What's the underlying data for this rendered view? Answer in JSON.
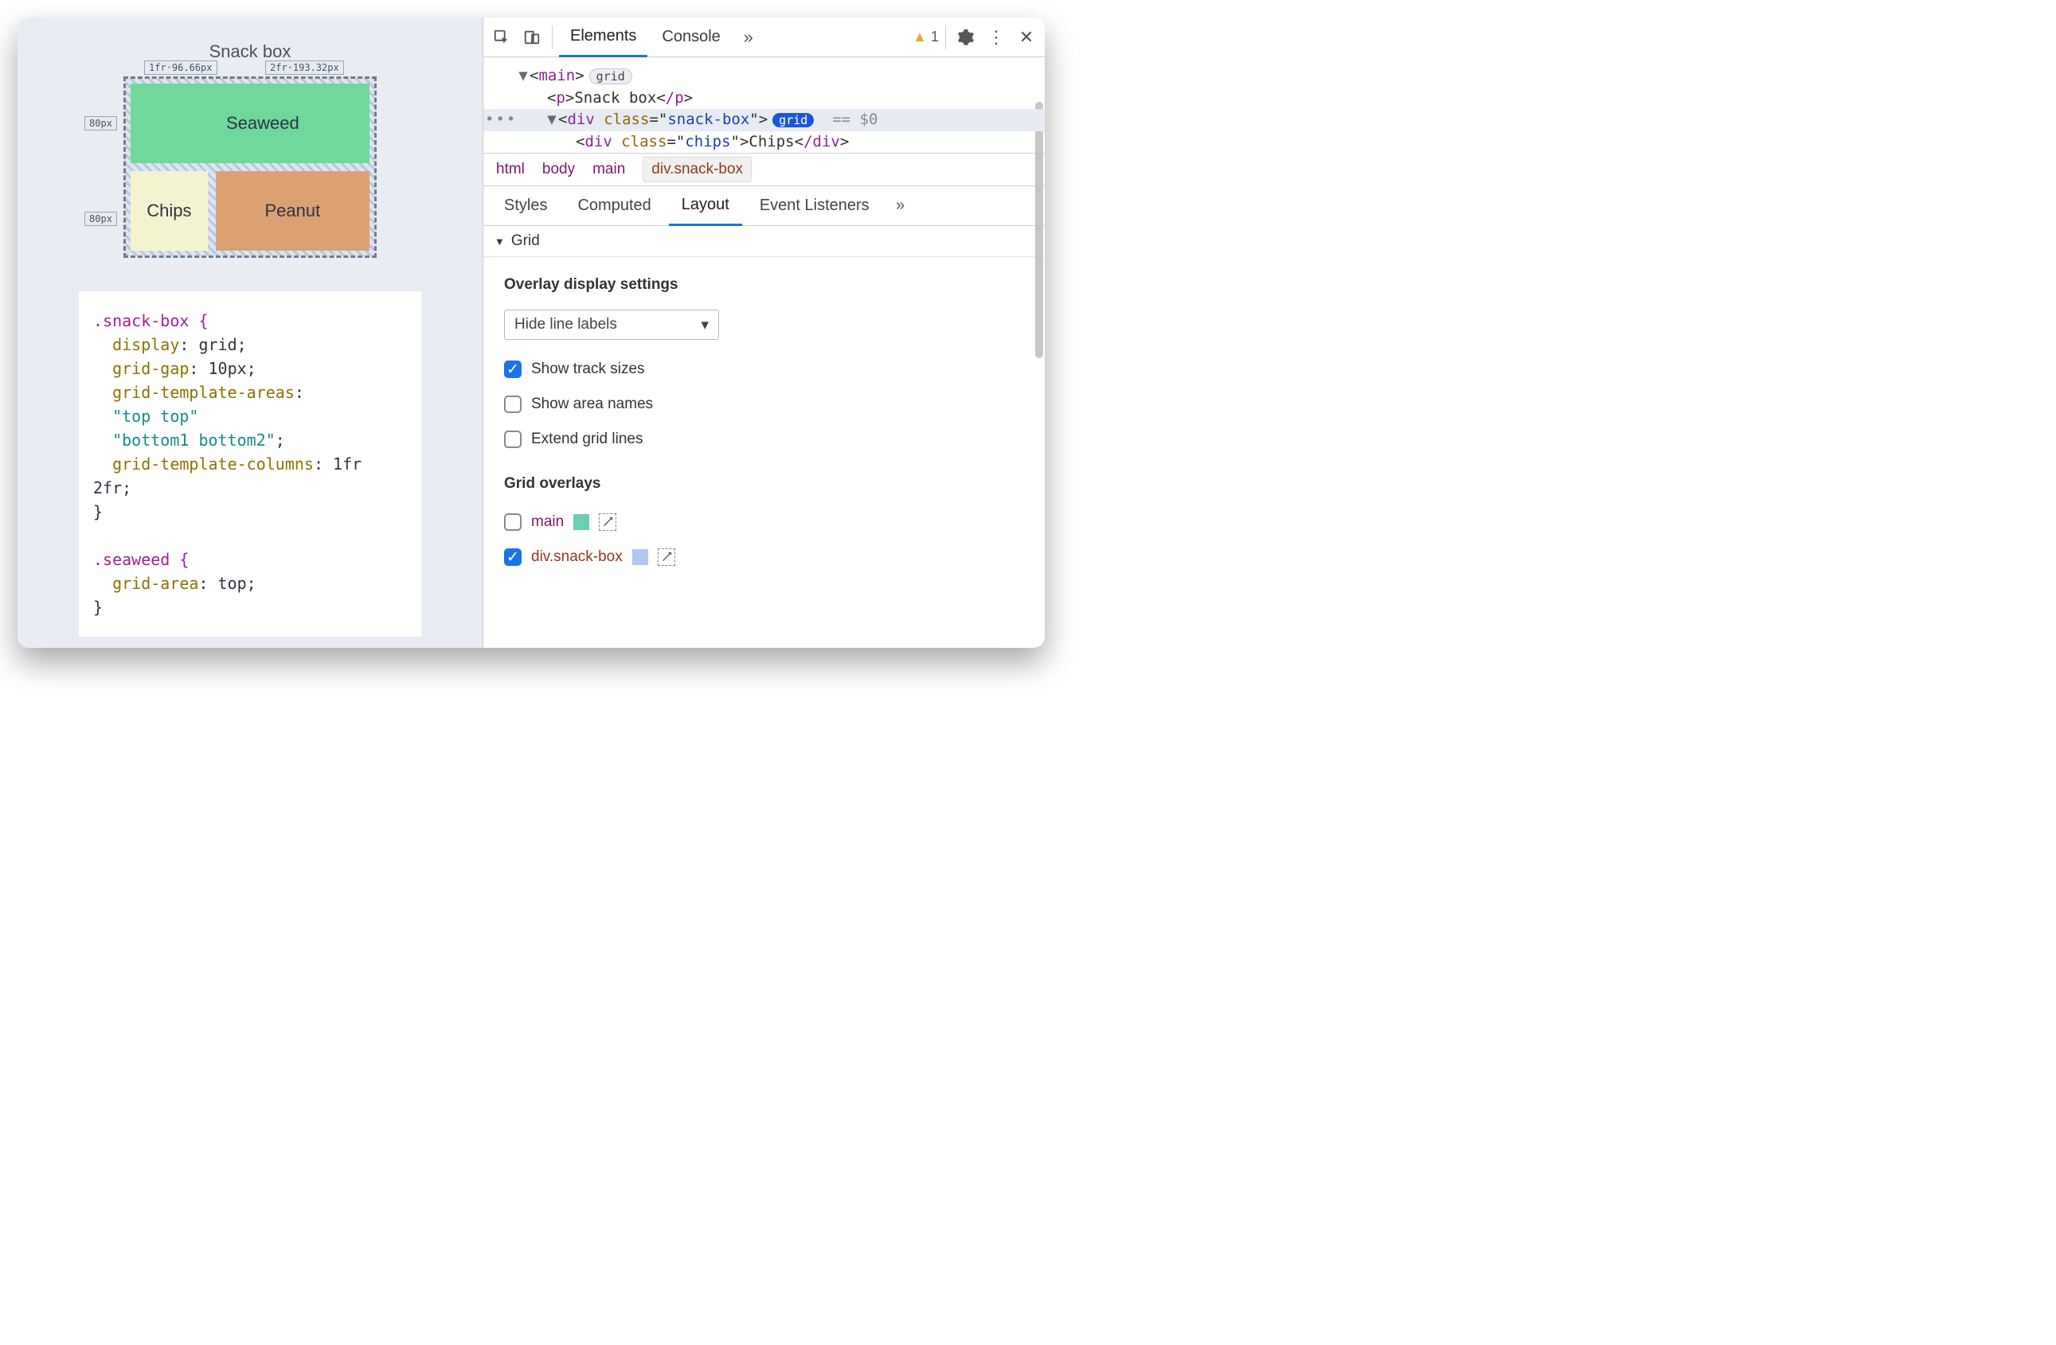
{
  "page": {
    "title": "Snack box",
    "cells": {
      "seaweed": "Seaweed",
      "chips": "Chips",
      "peanut": "Peanut"
    },
    "track_labels": {
      "col1": "1fr·96.66px",
      "col2": "2fr·193.32px",
      "row1": "80px",
      "row2": "80px"
    }
  },
  "css_code": {
    "rule1_selector": ".snack-box {",
    "r1p1n": "display",
    "r1p1v": ": grid;",
    "r1p2n": "grid-gap",
    "r1p2v": ": 10px;",
    "r1p3n": "grid-template-areas",
    "r1p3v": ":",
    "r1s1": "\"top top\"",
    "r1s2": "\"bottom1 bottom2\"",
    "r1s2t": ";",
    "r1p4n": "grid-template-columns",
    "r1p4v": ": 1fr 2fr;",
    "close1": "}",
    "rule2_selector": ".seaweed {",
    "r2p1n": "grid-area",
    "r2p1v": ": top;",
    "close2": "}"
  },
  "toolbar_tabs": {
    "elements": "Elements",
    "console": "Console"
  },
  "warning_count": "1",
  "dom": {
    "main_open": "main",
    "grid_badge": "grid",
    "p_open": "p",
    "p_text": "Snack box",
    "p_close": "/p",
    "div_open": "div",
    "class_attr": "class",
    "snack_val": "snack-box",
    "eq0": "== $0",
    "chips_val": "chips",
    "chips_text": "Chips",
    "div_close": "/div"
  },
  "breadcrumb": {
    "html": "html",
    "body": "body",
    "main": "main",
    "current": "div.snack-box"
  },
  "subtabs": {
    "styles": "Styles",
    "computed": "Computed",
    "layout": "Layout",
    "listeners": "Event Listeners"
  },
  "grid_section": "Grid",
  "overlay_settings": {
    "title": "Overlay display settings",
    "select": "Hide line labels",
    "opt1": "Show track sizes",
    "opt2": "Show area names",
    "opt3": "Extend grid lines"
  },
  "grid_overlays": {
    "title": "Grid overlays",
    "item1": "main",
    "item2": "div.snack-box",
    "swatch1": "#6ad0b3",
    "swatch2": "#b3c6f0"
  }
}
